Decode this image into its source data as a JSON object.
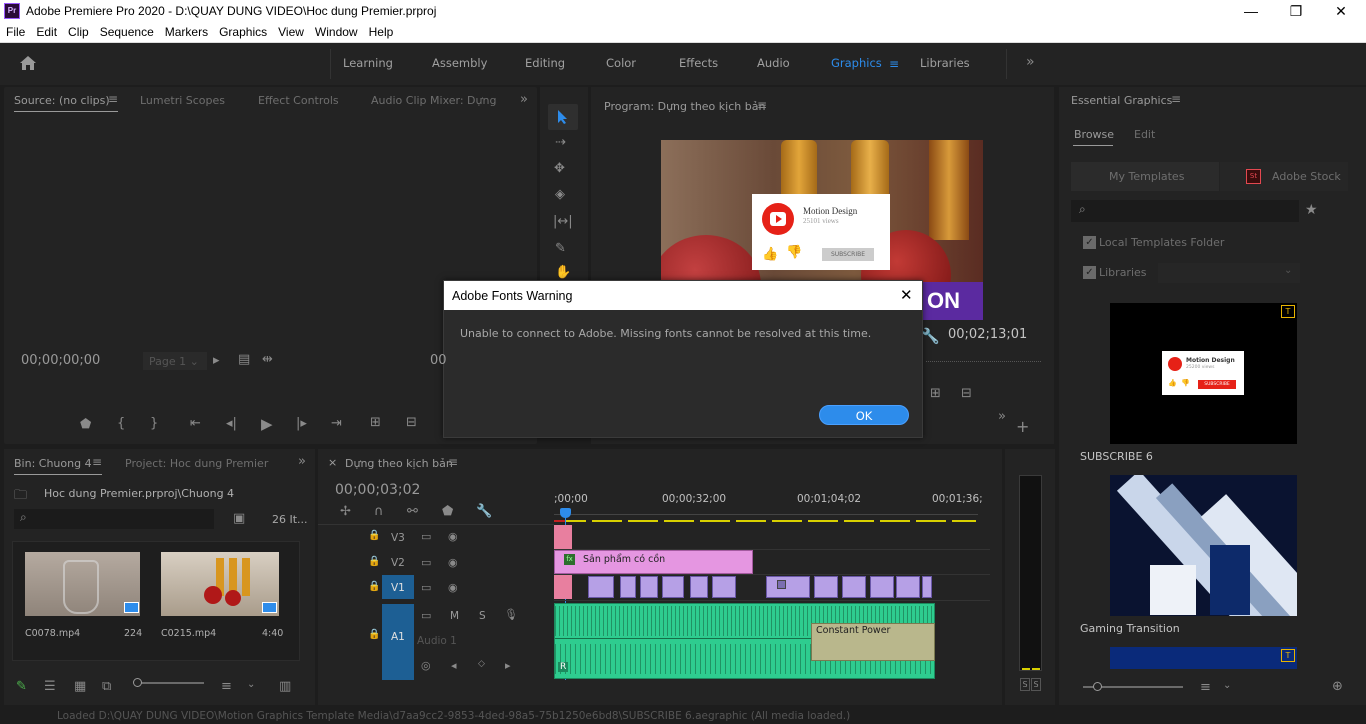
{
  "window": {
    "app_icon": "Pr",
    "title": "Adobe Premiere Pro 2020 - D:\\QUAY DUNG VIDEO\\Hoc dung Premier.prproj",
    "minimize": "—",
    "restore": "❐",
    "close": "✕"
  },
  "menu": [
    "File",
    "Edit",
    "Clip",
    "Sequence",
    "Markers",
    "Graphics",
    "View",
    "Window",
    "Help"
  ],
  "workspaces": {
    "items": [
      "Learning",
      "Assembly",
      "Editing",
      "Color",
      "Effects",
      "Audio",
      "Graphics",
      "Libraries"
    ],
    "active": "Graphics",
    "active_color": "#2d8ceb",
    "more": "»"
  },
  "source": {
    "tabs": [
      "Source: (no clips)",
      "Lumetri Scopes",
      "Effect Controls",
      "Audio Clip Mixer: Dựng th"
    ],
    "timecode": "00;00;00;00",
    "page": "Page 1"
  },
  "program": {
    "tab": "Program: Dựng theo kịch bản",
    "timecode": "00;02;13;01",
    "card_title": "Motion Design",
    "card_views": "25101 views",
    "card_subscribe": "SUBSCRIBE",
    "overlay_text": "ON",
    "left_timecode_fragment": "00"
  },
  "dialog": {
    "title": "Adobe Fonts Warning",
    "message": "Unable to connect to Adobe. Missing fonts cannot be resolved at this time.",
    "ok": "OK",
    "close": "✕"
  },
  "project": {
    "tabs": [
      "Bin: Chuong 4",
      "Project: Hoc dung Premier"
    ],
    "path": "Hoc dung Premier.prproj\\Chuong 4",
    "count": "26 It...",
    "clips": [
      {
        "name": "C0078.mp4",
        "duration": "224"
      },
      {
        "name": "C0215.mp4",
        "duration": "4:40"
      }
    ]
  },
  "timeline": {
    "tab": "Dựng theo kịch bản",
    "close": "×",
    "timecode": "00;00;03;02",
    "ruler": [
      ";00;00",
      "00;00;32;00",
      "00;01;04;02",
      "00;01;36;"
    ],
    "tracks": {
      "v3": "V3",
      "v2": "V2",
      "v1": "V1",
      "a1": "A1",
      "a1_name": "Audio 1",
      "m": "M",
      "s": "S",
      "r": "R"
    },
    "clip_v2": "Sản phẩm có cồn",
    "transition": "Constant Power",
    "fx": "fx"
  },
  "meter": {
    "s1": "S",
    "s2": "S"
  },
  "essential": {
    "title": "Essential Graphics",
    "tabs": [
      "Browse",
      "Edit"
    ],
    "sub_tabs": [
      "My Templates",
      "Adobe Stock"
    ],
    "stock_icon": "St",
    "local_folder": "Local Templates Folder",
    "libraries": "Libraries",
    "templates": [
      {
        "name": "SUBSCRIBE 6",
        "badge": "T"
      },
      {
        "name": "Gaming Transition"
      }
    ],
    "thumb_title": "Motion Design",
    "thumb_views": "25200 views",
    "thumb_subscribe": "SUBSCRIBE"
  },
  "status": {
    "text": "Loaded D:\\QUAY DUNG VIDEO\\Motion Graphics Template Media\\d7aa9cc2-9853-4ded-98a5-75b1250e6bd8\\SUBSCRIBE 6.aegraphic (All media loaded.)"
  }
}
